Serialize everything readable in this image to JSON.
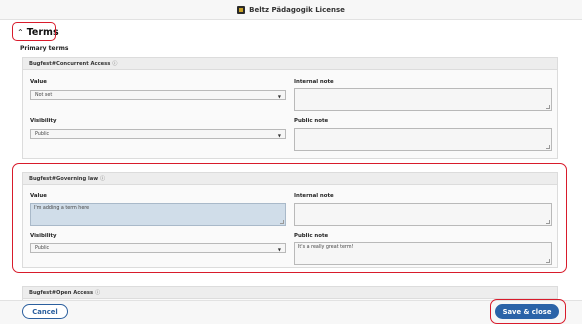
{
  "window": {
    "title": "Beltz Pädagogik License",
    "icon": "license-app-icon"
  },
  "terms_section": {
    "label": "Terms",
    "toggle_icon": "chevron-up-icon",
    "subheading": "Primary terms"
  },
  "cards": [
    {
      "header": "Bugfest#Concurrent Access",
      "info_icon": "ⓘ",
      "value_label": "Value",
      "value_select": "Not set",
      "internal_note_label": "Internal note",
      "internal_note_value": "",
      "visibility_label": "Visibility",
      "visibility_select": "Public",
      "public_note_label": "Public note",
      "public_note_value": ""
    },
    {
      "header": "Bugfest#Governing law",
      "info_icon": "ⓘ",
      "value_label": "Value",
      "value_text": "I'm adding a term here",
      "internal_note_label": "Internal note",
      "internal_note_value": "",
      "visibility_label": "Visibility",
      "visibility_select": "Public",
      "public_note_label": "Public note",
      "public_note_value": "It's a really great term!"
    },
    {
      "header": "Bugfest#Open Access",
      "info_icon": "ⓘ"
    }
  ],
  "footer": {
    "cancel_label": "Cancel",
    "save_label": "Save & close"
  },
  "colors": {
    "primary": "#2b63a8",
    "highlight": "#d81b2b",
    "value_fill": "#d0dde9"
  }
}
